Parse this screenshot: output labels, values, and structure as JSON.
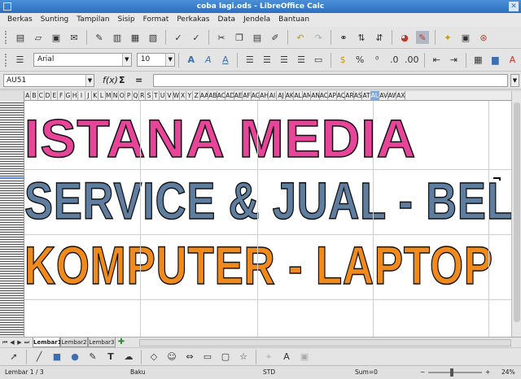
{
  "window": {
    "title": "coba lagi.ods - LibreOffice Calc",
    "close_glyph": "✕"
  },
  "menu": [
    "Berkas",
    "Sunting",
    "Tampilan",
    "Sisip",
    "Format",
    "Perkakas",
    "Data",
    "Jendela",
    "Bantuan"
  ],
  "formatting": {
    "font_name": "Arial",
    "font_size": "10"
  },
  "formula_bar": {
    "cell_ref": "AU51",
    "fx_label": "f(x)",
    "sum_glyph": "Σ",
    "equals_glyph": "=",
    "content": ""
  },
  "columns": [
    "A",
    "B",
    "C",
    "D",
    "E",
    "F",
    "G",
    "H",
    "I",
    "J",
    "K",
    "L",
    "M",
    "N",
    "O",
    "P",
    "Q",
    "R",
    "S",
    "T",
    "U",
    "V",
    "W",
    "X",
    "Y",
    "Z",
    "AA",
    "AB",
    "AC",
    "AD",
    "AE",
    "AF",
    "AG",
    "AH",
    "AI",
    "AJ",
    "AK",
    "AL",
    "AM",
    "AN",
    "AO",
    "AP",
    "AQ",
    "AR",
    "AS",
    "AT",
    "AU",
    "AV",
    "AW",
    "AX"
  ],
  "selected_column": "AU",
  "banner": {
    "line1": {
      "text": "ISTANA MEDIA",
      "color": "#e8449a"
    },
    "line2": {
      "text": "SERVICE & JUAL - BELI",
      "color": "#5f7d9f"
    },
    "line3": {
      "text": "KOMPUTER - LAPTOP",
      "color": "#f08a1c"
    }
  },
  "sheets": [
    {
      "label": "Lembar1",
      "active": true
    },
    {
      "label": "Lembar2",
      "active": false
    },
    {
      "label": "Lembar3",
      "active": false
    }
  ],
  "status": {
    "page": "Lembar 1 / 3",
    "style": "Baku",
    "mode": "STD",
    "sum": "Sum=0",
    "zoom": "24%"
  },
  "icons": {
    "toolbar1": [
      "new-document-icon",
      "open-folder-icon",
      "save-icon",
      "email-icon",
      "edit-file-icon",
      "export-pdf-icon",
      "print-icon",
      "print-preview-icon",
      "spellcheck-icon",
      "autospell-icon",
      "cut-icon",
      "copy-icon",
      "paste-icon",
      "clone-format-icon",
      "undo-icon",
      "redo-icon",
      "hyperlink-icon",
      "sort-ascending-icon",
      "sort-descending-icon",
      "chart-icon",
      "draw-functions-icon",
      "navigator-icon",
      "gallery-icon",
      "help-icon"
    ],
    "drawing": [
      "select-pointer-icon",
      "line-icon",
      "rectangle-icon",
      "ellipse-icon",
      "freeform-icon",
      "text-icon",
      "callout-icon",
      "basic-shapes-icon",
      "symbol-shapes-icon",
      "block-arrows-icon",
      "flowchart-icon",
      "callouts-icon",
      "stars-icon",
      "points-icon",
      "fontwork-icon",
      "extrusion-icon"
    ]
  }
}
